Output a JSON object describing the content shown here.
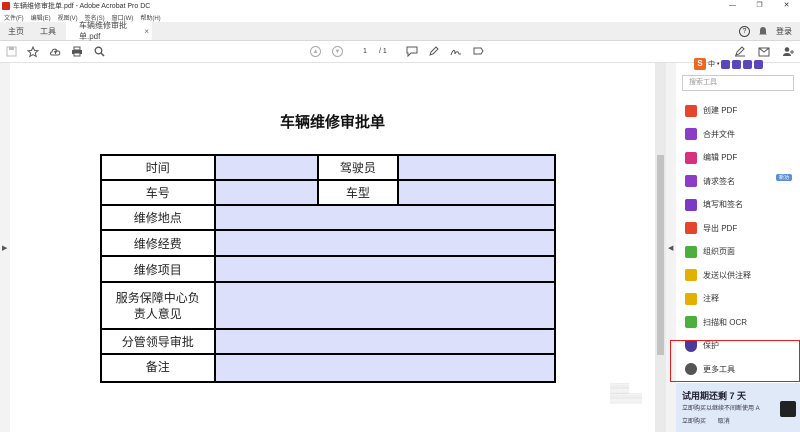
{
  "window": {
    "title": "车辆维修审批单.pdf - Adobe Acrobat Pro DC",
    "min": "—",
    "max": "❐",
    "close": "✕"
  },
  "menu": [
    "文件(F)",
    "编辑(E)",
    "视图(V)",
    "签名(S)",
    "窗口(W)",
    "帮助(H)"
  ],
  "tabs": {
    "home": "主页",
    "tools": "工具",
    "doc": "车辆维修审批单.pdf",
    "doc_close": "×"
  },
  "header_right": {
    "help": "?",
    "signin": "登录"
  },
  "toolbar": {
    "page_current": "1",
    "page_total": "/ 1"
  },
  "document": {
    "title": "车辆维修审批单",
    "rows": {
      "time": "时间",
      "driver": "驾驶员",
      "plate": "车号",
      "model": "车型",
      "location": "维修地点",
      "cost": "维修经费",
      "items": "维修项目",
      "opinion": "服务保障中心负责人意见",
      "leader": "分管领导审批",
      "notes": "备注"
    }
  },
  "right_panel": {
    "ime_logo": "S",
    "ime_text": "中 •",
    "search_placeholder": "搜索工具",
    "tools": [
      {
        "label": "创建 PDF",
        "color": "#e5452d"
      },
      {
        "label": "合并文件",
        "color": "#8c3dc7"
      },
      {
        "label": "编辑 PDF",
        "color": "#d6317c"
      },
      {
        "label": "请求签名",
        "color": "#8c3dc7",
        "badge": "新功"
      },
      {
        "label": "填写和签名",
        "color": "#7a3bc4"
      },
      {
        "label": "导出 PDF",
        "color": "#e5452d"
      },
      {
        "label": "组织页面",
        "color": "#4cae3c"
      },
      {
        "label": "发送以供注释",
        "color": "#e3b000"
      },
      {
        "label": "注释",
        "color": "#e3b000"
      },
      {
        "label": "扫描和 OCR",
        "color": "#4cae3c"
      },
      {
        "label": "保护",
        "color": "#4a3a9a"
      },
      {
        "label": "更多工具",
        "color": "#555555"
      }
    ]
  },
  "trial": {
    "headline": "试用期还剩 7 天",
    "body": "立即购买以继续不间断使用 A",
    "buy": "立即购买",
    "cancel": "取消"
  }
}
